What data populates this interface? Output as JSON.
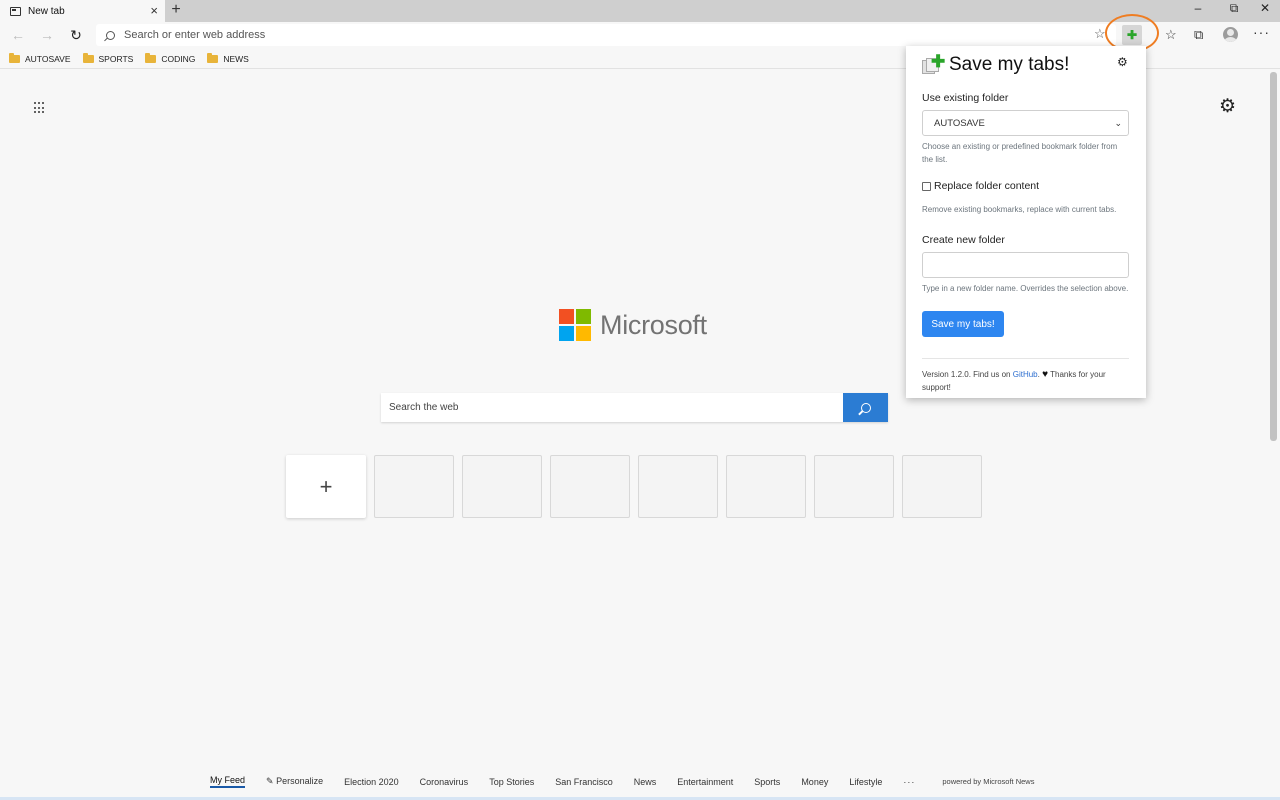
{
  "browser": {
    "tab_title": "New tab",
    "tab_close": "×",
    "new_tab": "+",
    "window_minimize": "–",
    "window_restore": "⧉",
    "window_close": "✕",
    "address_placeholder": "Search or enter web address",
    "more": "···"
  },
  "bookmarks": [
    {
      "label": "AUTOSAVE"
    },
    {
      "label": "SPORTS"
    },
    {
      "label": "CODING"
    },
    {
      "label": "NEWS"
    }
  ],
  "newtab": {
    "brand": "Microsoft",
    "brand_colors": [
      "#f25022",
      "#7fba00",
      "#00a4ef",
      "#ffb900"
    ],
    "search_placeholder": "Search the web",
    "add_tile": "+",
    "empty_tile_count_note": "",
    "feed": {
      "items": [
        "My Feed",
        "Personalize",
        "Election 2020",
        "Coronavirus",
        "Top Stories",
        "San Francisco",
        "News",
        "Entertainment",
        "Sports",
        "Money",
        "Lifestyle"
      ],
      "more": "···",
      "powered_by": "powered by Microsoft News"
    }
  },
  "popup": {
    "title": "Save my tabs!",
    "existing_label": "Use existing folder",
    "existing_value": "AUTOSAVE",
    "existing_help": "Choose an existing or predefined bookmark folder from the list.",
    "replace_label": "Replace folder content",
    "replace_checked": false,
    "replace_help": "Remove existing bookmarks, replace with current tabs.",
    "new_folder_label": "Create new folder",
    "new_folder_value": "",
    "new_folder_help": "Type in a new folder name. Overrides the selection above.",
    "save_button": "Save my tabs!",
    "footer_prefix": "Version 1.2.0. Find us on ",
    "footer_link": "GitHub",
    "footer_suffix": " Thanks for your support!",
    "accent_color": "#2e86f0"
  },
  "highlight_color": "#ef7d22"
}
